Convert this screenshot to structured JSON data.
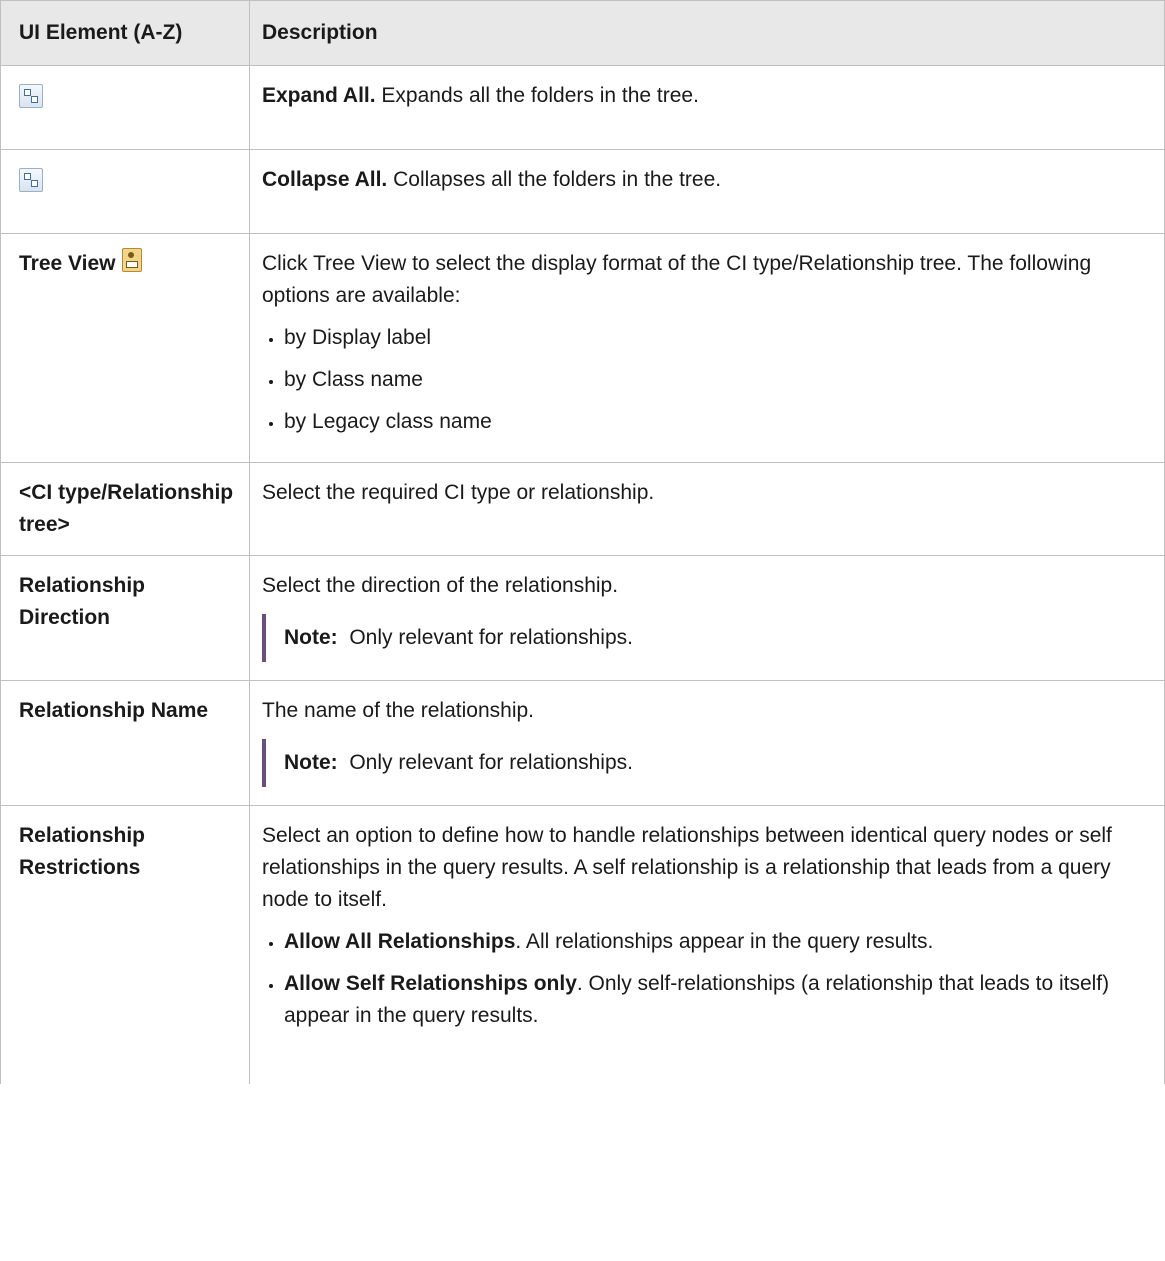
{
  "table": {
    "header": {
      "col1": "UI Element (A-Z)",
      "col2": "Description"
    },
    "expand_all": {
      "icon": "expand-all-icon",
      "term": "Expand All.",
      "text": " Expands all the folders in the tree."
    },
    "collapse_all": {
      "icon": "collapse-all-icon",
      "term": "Collapse All.",
      "text": " Collapses all the folders in the tree."
    },
    "tree_view": {
      "label": "Tree View",
      "icon": "tree-view-icon",
      "desc": "Click Tree View to select the display format of the CI type/Relationship tree. The following options are available:",
      "options": [
        "by Display label",
        "by Class name",
        "by Legacy class name"
      ]
    },
    "ci_tree": {
      "label": "<CI type/Relationship tree>",
      "desc": "Select the required CI type or relationship."
    },
    "rel_direction": {
      "label": "Relationship Direction",
      "desc": "Select the direction of the relationship.",
      "note_label": "Note:",
      "note_text": "  Only relevant for relationships."
    },
    "rel_name": {
      "label": "Relationship Name",
      "desc": "The name of the relationship.",
      "note_label": "Note:",
      "note_text": "  Only relevant for relationships."
    },
    "rel_restrictions": {
      "label": "Relationship Restrictions",
      "desc": "Select an option to define how to handle relationships between identical query nodes or self relationships in the query results. A self relationship is a relationship that leads from a query node to itself.",
      "options": [
        {
          "term": "Allow All Relationships",
          "text": ". All relationships appear in the query results."
        },
        {
          "term": "Allow Self Relationships only",
          "text": ". Only self-relationships (a relationship that leads to itself) appear in the query results."
        }
      ]
    }
  }
}
